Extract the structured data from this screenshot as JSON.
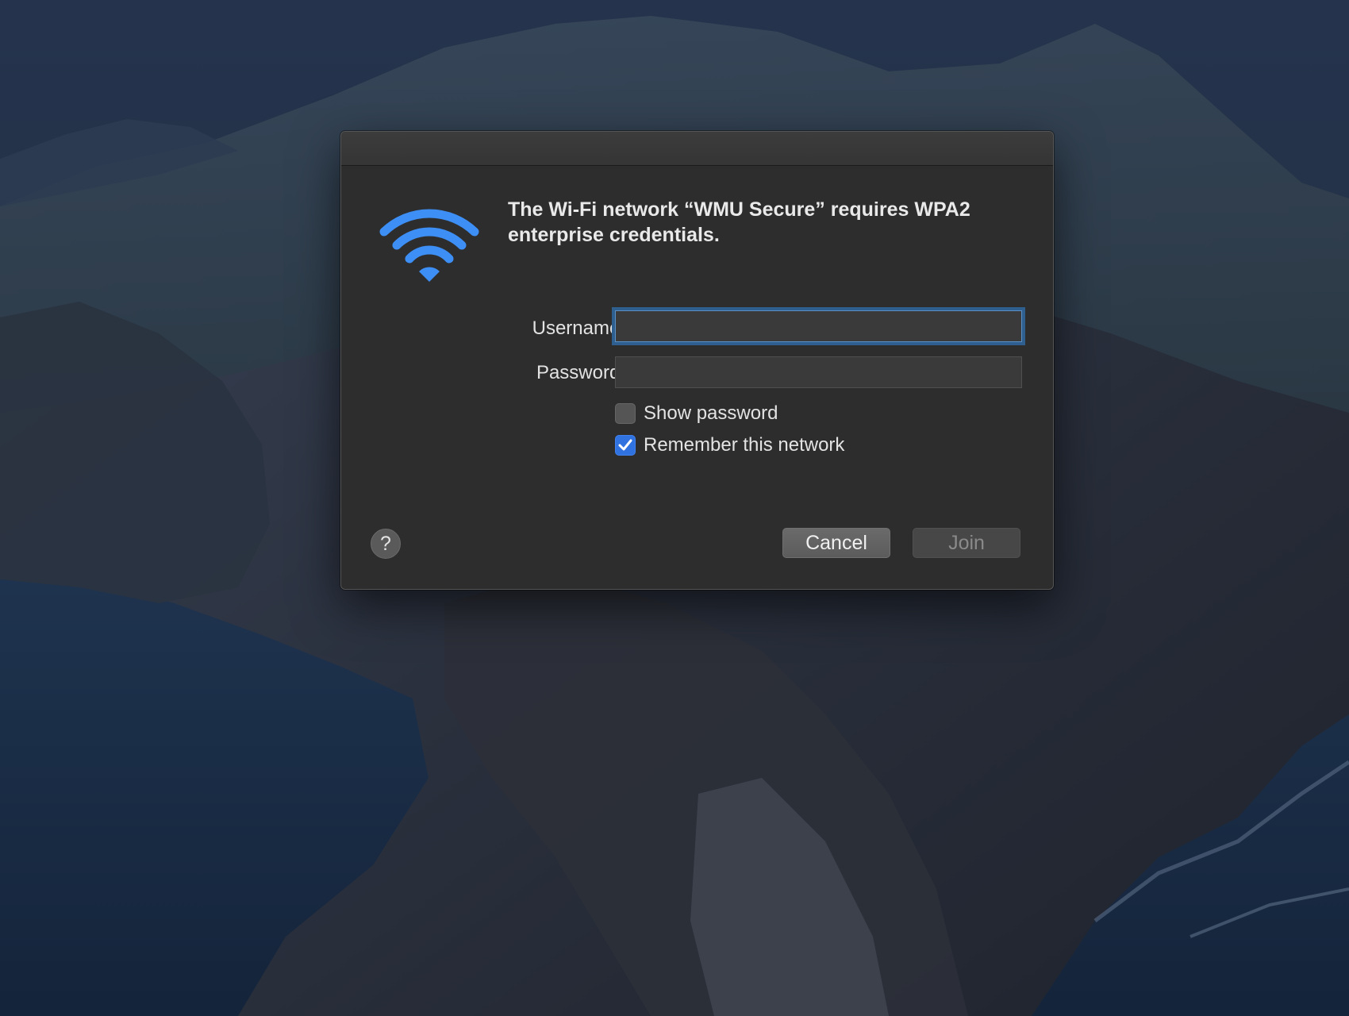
{
  "dialog": {
    "message": "The Wi-Fi network “WMU Secure” requires WPA2 enterprise credentials.",
    "icon": "wifi-icon",
    "username_label": "Username:",
    "username_value": "",
    "password_label": "Password:",
    "password_value": "",
    "show_password_label": "Show password",
    "show_password_checked": false,
    "remember_label": "Remember this network",
    "remember_checked": true,
    "help_label": "?",
    "cancel_label": "Cancel",
    "join_label": "Join",
    "join_enabled": false
  },
  "colors": {
    "accent": "#2f72e0",
    "wifi_blue": "#3d8ff5",
    "dialog_bg": "#2d2d2d"
  }
}
